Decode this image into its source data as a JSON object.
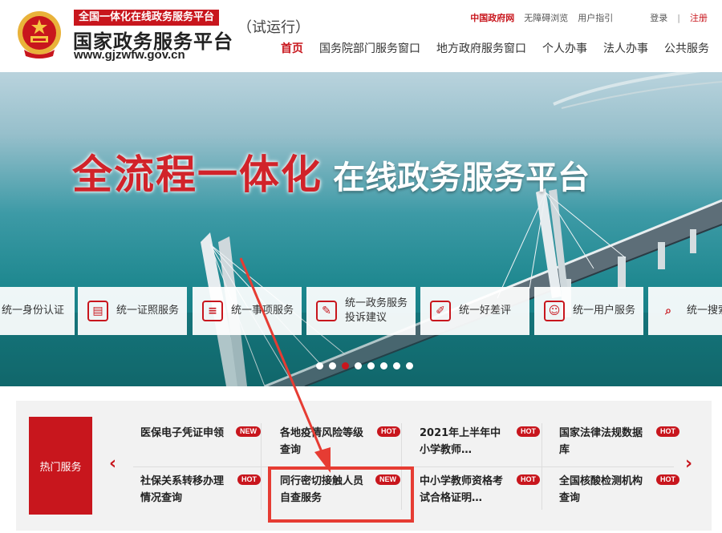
{
  "header": {
    "site_tag": "全国一体化在线政务服务平台",
    "site_title": "国家政务服务平台",
    "trial": "（试运行）",
    "site_url": "www.gjzwfw.gov.cn",
    "top_links": {
      "gov": "中国政府网",
      "accessible": "无障碍浏览",
      "guide": "用户指引",
      "login": "登录",
      "separator": "|",
      "register": "注册"
    },
    "nav": [
      "首页",
      "国务院部门服务窗口",
      "地方政府服务窗口",
      "个人办事",
      "法人办事",
      "公共服务"
    ]
  },
  "banner": {
    "headline_red": "全流程一体化",
    "headline_white": "在线政务服务平台",
    "quick_services": [
      {
        "label": "统一身份认证",
        "icon": "id-card-icon"
      },
      {
        "label": "统一证照服务",
        "icon": "license-card-icon"
      },
      {
        "label": "统一事项服务",
        "icon": "document-list-icon"
      },
      {
        "label": "统一政务服务投诉建议",
        "icon": "edit-form-icon"
      },
      {
        "label": "统一好差评",
        "icon": "pen-rating-icon"
      },
      {
        "label": "统一用户服务",
        "icon": "user-gear-icon"
      },
      {
        "label": "统一搜索",
        "icon": "search-icon"
      }
    ],
    "carousel_dots": 8,
    "active_dot": 3
  },
  "hot_services": {
    "tab": "热门服务",
    "items": [
      {
        "title": "医保电子凭证申领",
        "badge": "NEW"
      },
      {
        "title": "各地疫情风险等级查询",
        "badge": "HOT"
      },
      {
        "title": "2021年上半年中小学教师…",
        "badge": "HOT"
      },
      {
        "title": "国家法律法规数据库",
        "badge": "HOT"
      },
      {
        "title": "社保关系转移办理情况查询",
        "badge": "HOT"
      },
      {
        "title": "同行密切接触人员自查服务",
        "badge": "NEW"
      },
      {
        "title": "中小学教师资格考试合格证明…",
        "badge": "HOT"
      },
      {
        "title": "全国核酸检测机构查询",
        "badge": "HOT"
      }
    ]
  },
  "colors": {
    "brand_red": "#c8161d",
    "annotation_red": "#e63c33"
  }
}
